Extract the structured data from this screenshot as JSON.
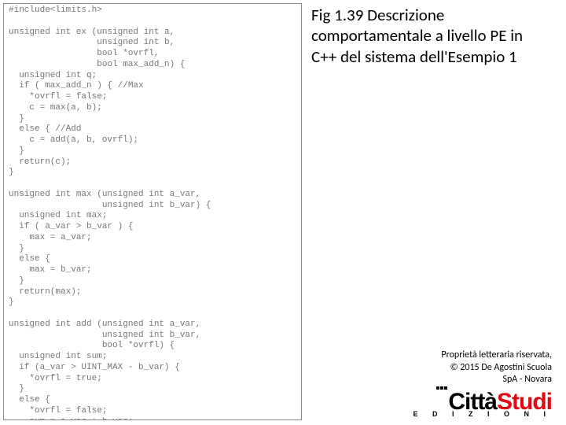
{
  "code": "#include<limits.h>\n\nunsigned int ex (unsigned int a,\n                 unsigned int b,\n                 bool *ovrfl,\n                 bool max_add_n) {\n  unsigned int q;\n  if ( max_add_n ) { //Max\n    *ovrfl = false;\n    c = max(a, b);\n  }\n  else { //Add\n    c = add(a, b, ovrfl);\n  }\n  return(c);\n}\n\nunsigned int max (unsigned int a_var,\n                  unsigned int b_var) {\n  unsigned int max;\n  if ( a_var > b_var ) {\n    max = a_var;\n  }\n  else {\n    max = b_var;\n  }\n  return(max);\n}\n\nunsigned int add (unsigned int a_var,\n                  unsigned int b_var,\n                  bool *ovrfl) {\n  unsigned int sum;\n  if (a_var > UINT_MAX - b_var) {\n    *ovrfl = true;\n  }\n  else {\n    *ovrfl = false;\n    sum = a_var + b_var;\n  }\n  return(sum);\n}",
  "caption": "Fig 1.39 Descrizione comportamentale a livello PE in C++ del sistema dell'Esempio 1",
  "copyright": {
    "line1": "Proprietà letteraria riservata,",
    "line2": "© 2015 De Agostini Scuola",
    "line3": "SpA - Novara"
  },
  "brand": {
    "part1": "Città",
    "part2": "Studi",
    "sub": "E D I Z I O N I"
  }
}
